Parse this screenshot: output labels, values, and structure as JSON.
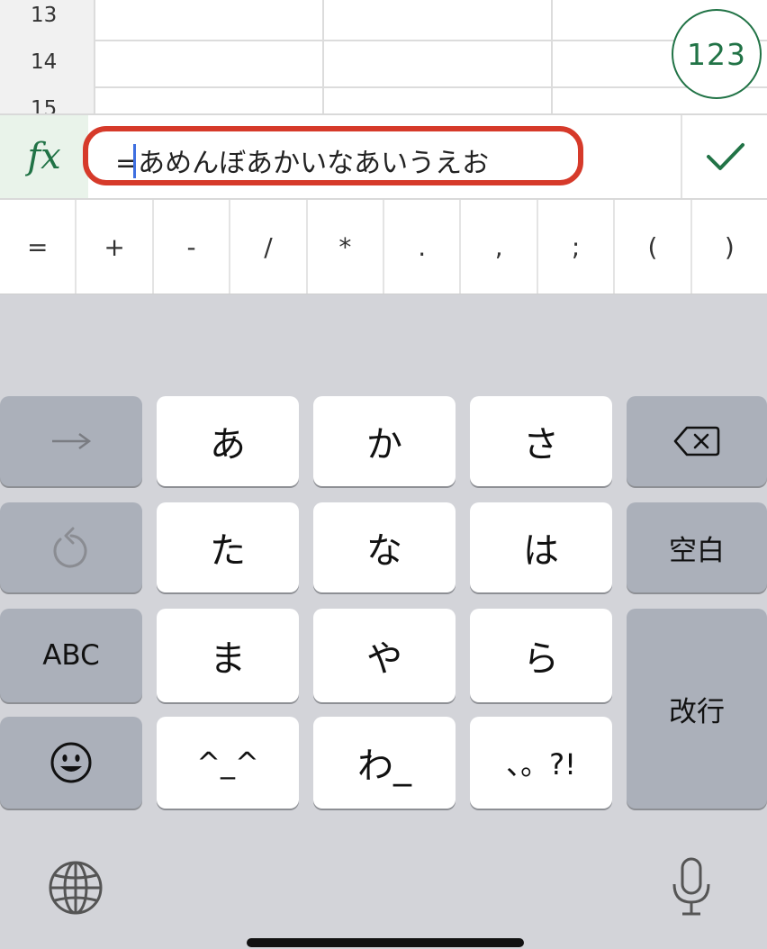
{
  "sheet": {
    "rows": [
      "13",
      "14",
      "15"
    ],
    "badge_label": "123"
  },
  "formula_bar": {
    "fx_label": "fx",
    "formula": "=あめんぼあかいなあいうえお"
  },
  "operators": [
    "=",
    "+",
    "-",
    "/",
    "*",
    ".",
    ",",
    ";",
    "(",
    ")"
  ],
  "keyboard": {
    "row1": [
      "あ",
      "か",
      "さ"
    ],
    "row2": [
      "た",
      "な",
      "は"
    ],
    "row3": [
      "ま",
      "や",
      "ら"
    ],
    "row4": [
      "^_^",
      "わ_",
      "、。?!"
    ],
    "abc_label": "ABC",
    "space_label": "空白",
    "return_label": "改行"
  }
}
